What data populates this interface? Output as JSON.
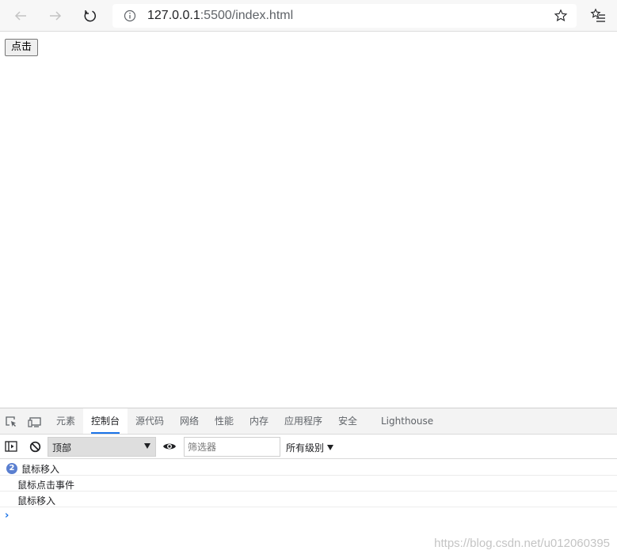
{
  "browser": {
    "url_host": "127.0.0.1",
    "url_rest": ":5500/index.html"
  },
  "page": {
    "button_label": "点击"
  },
  "devtools": {
    "tabs": [
      {
        "label": "元素"
      },
      {
        "label": "控制台",
        "active": true
      },
      {
        "label": "源代码"
      },
      {
        "label": "网络"
      },
      {
        "label": "性能"
      },
      {
        "label": "内存"
      },
      {
        "label": "应用程序"
      },
      {
        "label": "安全"
      },
      {
        "label": "Lighthouse"
      }
    ],
    "console": {
      "context": "顶部",
      "filter_placeholder": "筛选器",
      "levels": "所有级别",
      "messages": [
        {
          "count": "2",
          "text": "鼠标移入"
        },
        {
          "text": "鼠标点击事件"
        },
        {
          "text": "鼠标移入"
        }
      ]
    }
  },
  "watermark": "https://blog.csdn.net/u012060395",
  "colors": {
    "accent": "#1a73e8",
    "count_badge": "#5a7fd0"
  },
  "icons": [
    "back-arrow-icon",
    "forward-arrow-icon",
    "reload-icon",
    "info-icon",
    "star-icon",
    "favorites-icon",
    "inspect-icon",
    "device-icon",
    "sidebar-icon",
    "clear-icon",
    "eye-icon"
  ]
}
